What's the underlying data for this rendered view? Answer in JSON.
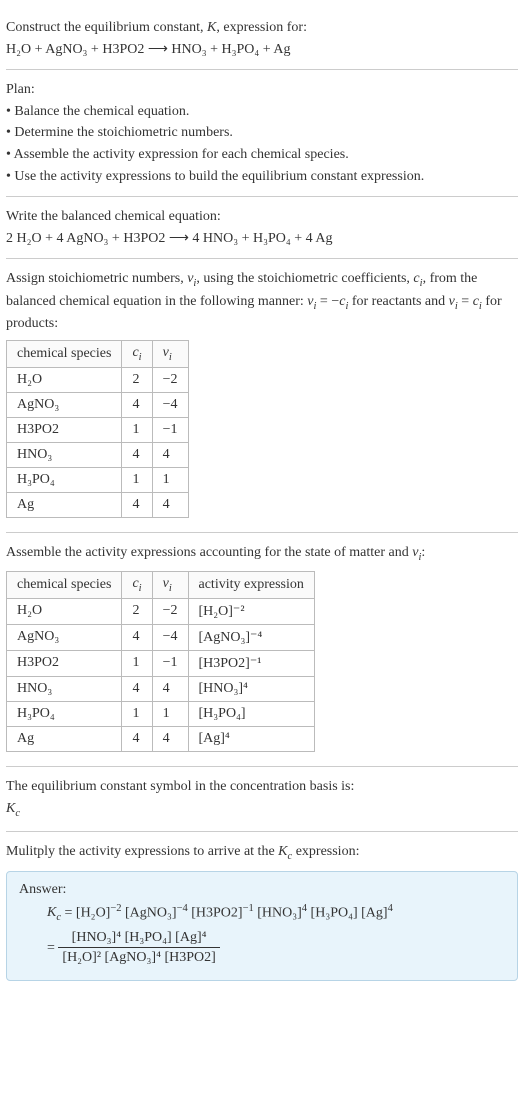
{
  "s1": {
    "title": "Construct the equilibrium constant, K, expression for:",
    "eq": "H₂O + AgNO₃ + H3PO2 ⟶ HNO₃ + H₃PO₄ + Ag"
  },
  "s2": {
    "title": "Plan:",
    "b1": "• Balance the chemical equation.",
    "b2": "• Determine the stoichiometric numbers.",
    "b3": "• Assemble the activity expression for each chemical species.",
    "b4": "• Use the activity expressions to build the equilibrium constant expression."
  },
  "s3": {
    "title": "Write the balanced chemical equation:",
    "eq": "2 H₂O + 4 AgNO₃ + H3PO2 ⟶ 4 HNO₃ + H₃PO₄ + 4 Ag"
  },
  "s4": {
    "title": "Assign stoichiometric numbers, νᵢ, using the stoichiometric coefficients, cᵢ, from the balanced chemical equation in the following manner: νᵢ = −cᵢ for reactants and νᵢ = cᵢ for products:",
    "h1": "chemical species",
    "h2": "cᵢ",
    "h3": "νᵢ",
    "rows": [
      {
        "sp": "H₂O",
        "c": "2",
        "v": "−2"
      },
      {
        "sp": "AgNO₃",
        "c": "4",
        "v": "−4"
      },
      {
        "sp": "H3PO2",
        "c": "1",
        "v": "−1"
      },
      {
        "sp": "HNO₃",
        "c": "4",
        "v": "4"
      },
      {
        "sp": "H₃PO₄",
        "c": "1",
        "v": "1"
      },
      {
        "sp": "Ag",
        "c": "4",
        "v": "4"
      }
    ]
  },
  "s5": {
    "title": "Assemble the activity expressions accounting for the state of matter and νᵢ:",
    "h1": "chemical species",
    "h2": "cᵢ",
    "h3": "νᵢ",
    "h4": "activity expression",
    "rows": [
      {
        "sp": "H₂O",
        "c": "2",
        "v": "−2",
        "a": "[H₂O]⁻²"
      },
      {
        "sp": "AgNO₃",
        "c": "4",
        "v": "−4",
        "a": "[AgNO₃]⁻⁴"
      },
      {
        "sp": "H3PO2",
        "c": "1",
        "v": "−1",
        "a": "[H3PO2]⁻¹"
      },
      {
        "sp": "HNO₃",
        "c": "4",
        "v": "4",
        "a": "[HNO₃]⁴"
      },
      {
        "sp": "H₃PO₄",
        "c": "1",
        "v": "1",
        "a": "[H₃PO₄]"
      },
      {
        "sp": "Ag",
        "c": "4",
        "v": "4",
        "a": "[Ag]⁴"
      }
    ]
  },
  "s6": {
    "l1": "The equilibrium constant symbol in the concentration basis is:",
    "l2": "K_c"
  },
  "s7": {
    "title": "Mulitply the activity expressions to arrive at the K_c expression:"
  },
  "answer": {
    "label": "Answer:",
    "line1": "K_c = [H₂O]⁻² [AgNO₃]⁻⁴ [H3PO2]⁻¹ [HNO₃]⁴ [H₃PO₄] [Ag]⁴",
    "eq_prefix": "= ",
    "num": "[HNO₃]⁴ [H₃PO₄] [Ag]⁴",
    "den": "[H₂O]² [AgNO₃]⁴ [H3PO2]"
  }
}
